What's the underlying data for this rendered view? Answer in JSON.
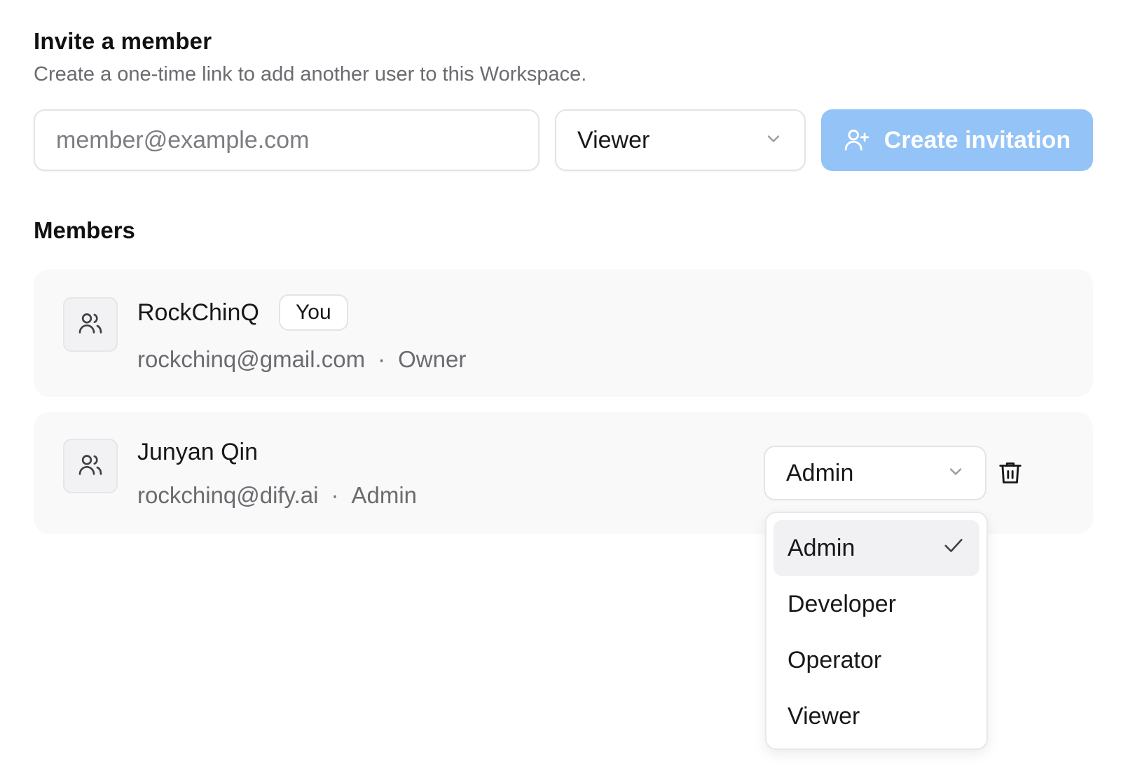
{
  "invite": {
    "title": "Invite a member",
    "subtitle": "Create a one-time link to add another user to this Workspace.",
    "email_placeholder": "member@example.com",
    "role_value": "Viewer",
    "create_button_label": "Create invitation"
  },
  "members_section": {
    "title": "Members",
    "members": [
      {
        "name": "RockChinQ",
        "badge": "You",
        "email": "rockchinq@gmail.com",
        "separator": "·",
        "role": "Owner"
      },
      {
        "name": "Junyan Qin",
        "email": "rockchinq@dify.ai",
        "separator": "·",
        "role": "Admin",
        "role_select_value": "Admin"
      }
    ]
  },
  "role_dropdown": {
    "selected": "Admin",
    "options": [
      "Admin",
      "Developer",
      "Operator",
      "Viewer"
    ]
  },
  "icons": {
    "avatar": "users-icon",
    "chevron": "chevron-down-icon",
    "create": "user-plus-icon",
    "delete": "trash-icon",
    "check": "check-icon"
  },
  "colors": {
    "primary_disabled": "#93c3f7",
    "card_bg": "#f9f9fa",
    "muted_text": "#6b6b70"
  }
}
